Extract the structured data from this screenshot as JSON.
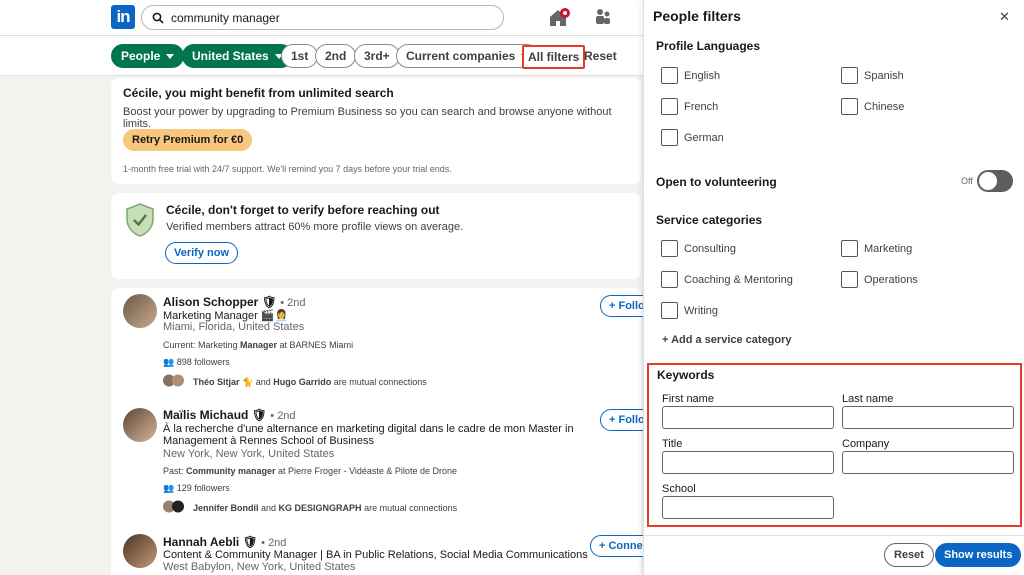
{
  "search": {
    "value": "community manager"
  },
  "filters": {
    "people": "People",
    "country": "United States",
    "first": "1st",
    "second": "2nd",
    "third": "3rd+",
    "companies": "Current companies",
    "all": "All filters",
    "reset": "Reset"
  },
  "premium": {
    "title": "Cécile, you might benefit from unlimited search",
    "body": "Boost your power by upgrading to Premium Business so you can search and browse anyone without limits.",
    "button": "Retry Premium for €0",
    "note": "1-month free trial with 24/7 support. We'll remind you 7 days before your trial ends."
  },
  "verify": {
    "title": "Cécile, don't forget to verify before reaching out",
    "body": "Verified members attract 60% more profile views on average.",
    "button": "Verify now"
  },
  "results": [
    {
      "name": "Alison Schopper",
      "degree": "• 2nd",
      "headline": "Marketing Manager 🎬👩‍💼",
      "location": "Miami, Florida, United States",
      "current_prefix": "Current: Marketing ",
      "current_bold": "Manager",
      "current_suffix": " at BARNES Miami",
      "followers": "898 followers",
      "mutual_a": "Théo Sitjar",
      "mutual_mid": " 🐈 and ",
      "mutual_b": "Hugo Garrido",
      "mutual_tail": " are mutual connections",
      "action": "Follow"
    },
    {
      "name": "Maïlis Michaud",
      "degree": "• 2nd",
      "headline": "À la recherche d'une alternance en marketing digital dans le cadre de mon Master in",
      "headline2": "Management à Rennes School of Business",
      "location": "New York, New York, United States",
      "current_prefix": "Past: ",
      "current_bold": "Community manager",
      "current_suffix": " at Pierre Froger - Vidéaste & Pilote de Drone",
      "followers": "129 followers",
      "mutual_a": "Jennifer Bondil",
      "mutual_mid": " and ",
      "mutual_b": "KG DESIGNGRAPH",
      "mutual_tail": " are mutual connections",
      "action": "Follow"
    },
    {
      "name": "Hannah Aebli",
      "degree": "• 2nd",
      "headline": "Content & Community Manager | BA in Public Relations, Social Media Communications",
      "location": "West Babylon, New York, United States",
      "action": "Connect"
    }
  ],
  "panel": {
    "title": "People filters",
    "close": "✕",
    "languages_title": "Profile Languages",
    "languages": [
      "English",
      "Spanish",
      "French",
      "Chinese",
      "German"
    ],
    "volunteer_title": "Open to volunteering",
    "volunteer_state": "Off",
    "services_title": "Service categories",
    "services": [
      "Consulting",
      "Marketing",
      "Coaching & Mentoring",
      "Operations",
      "Writing"
    ],
    "add_service": "+ Add a service category",
    "keywords_title": "Keywords",
    "first_name": "First name",
    "last_name": "Last name",
    "title_label": "Title",
    "company": "Company",
    "school": "School",
    "reset": "Reset",
    "show": "Show results"
  },
  "colors": {
    "brand": "#0a66c2",
    "green": "#01754f",
    "highlight": "#e03d2a",
    "premium": "#f8c77e"
  }
}
